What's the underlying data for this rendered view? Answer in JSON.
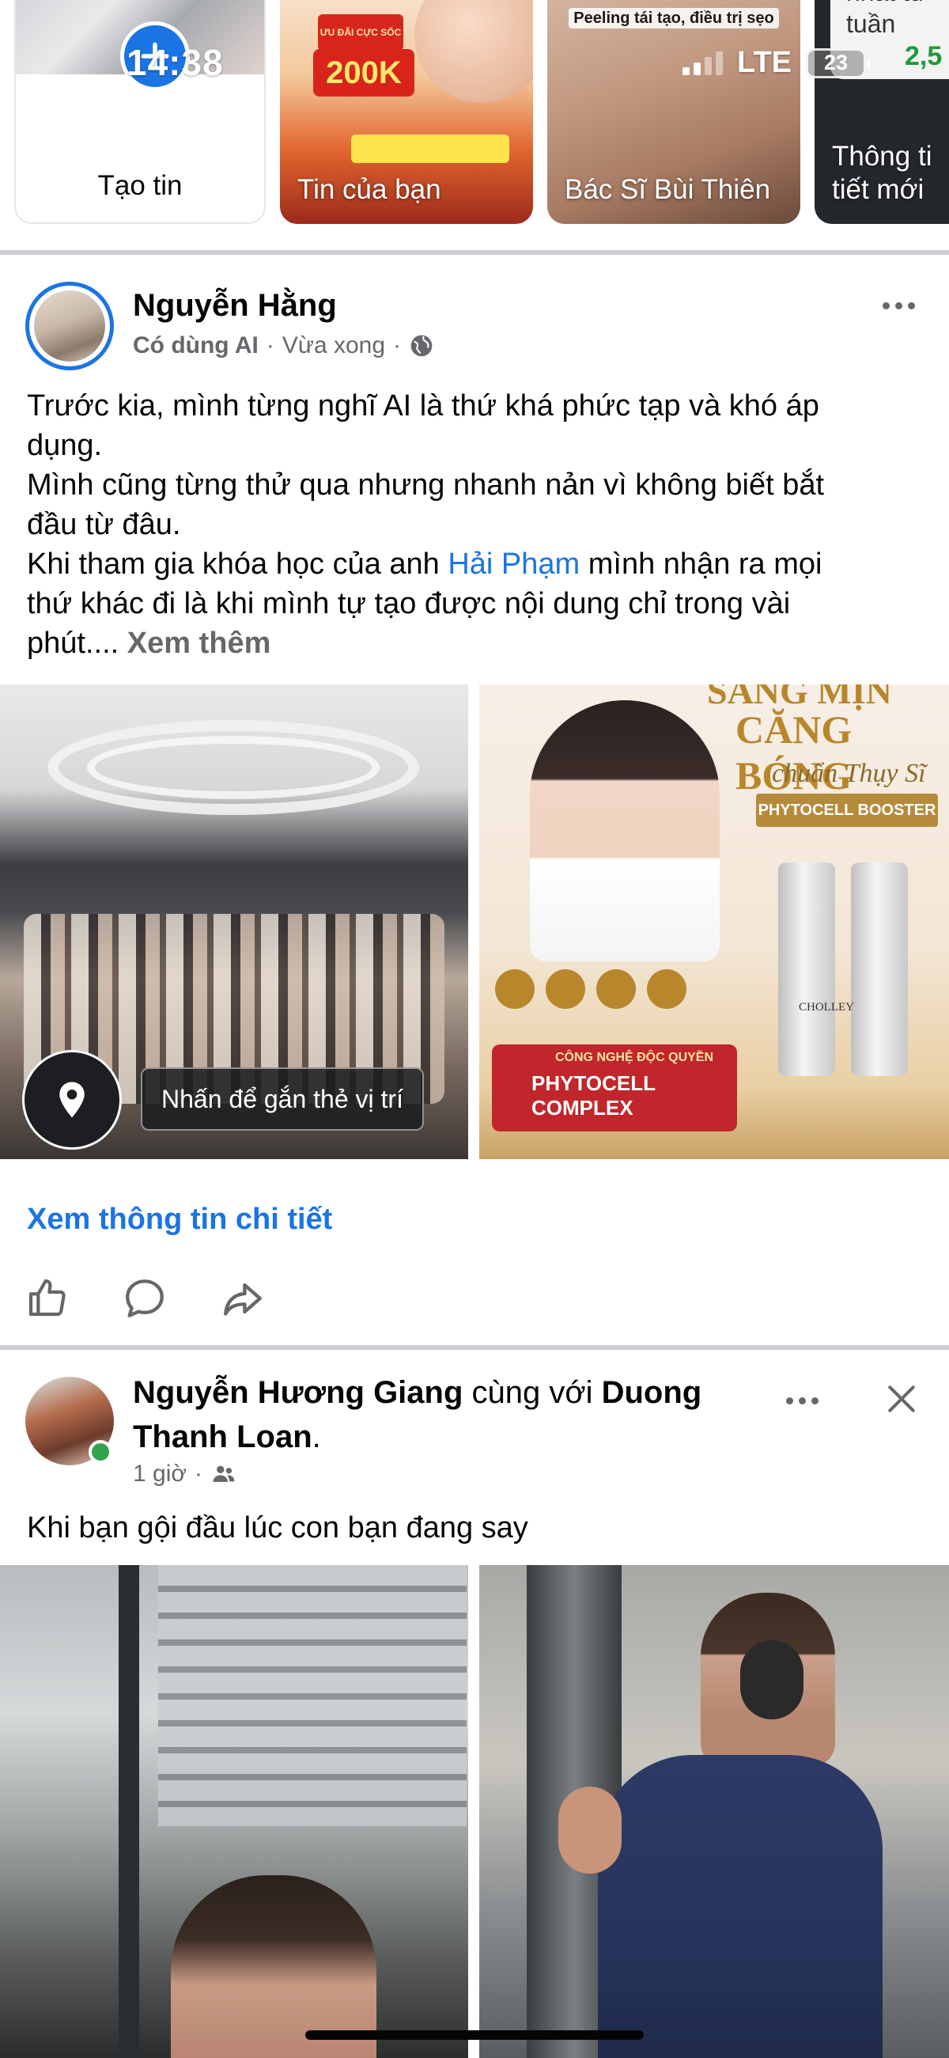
{
  "status_bar": {
    "time": "14:38",
    "network": "LTE",
    "battery": "23"
  },
  "stories": [
    {
      "label": "Tạo tin"
    },
    {
      "label": "Tin của bạn",
      "badge": "200K",
      "promo_text": "ƯU ĐÃI CỰC SỐC"
    },
    {
      "label": "Bác Sĩ Bùi Thiên",
      "caption": "Peeling tái tạo, điều trị sẹo"
    },
    {
      "label_line1": "Thông ti",
      "label_line2": "tiết mới",
      "card_line1": "nhất tu",
      "card_line2": "tuần",
      "card_value": "2,5"
    }
  ],
  "post1": {
    "author": "Nguyễn Hằng",
    "meta_tag": "Có dùng AI",
    "time": "Vừa xong",
    "text_line1": "Trước kia, mình từng nghĩ AI là thứ khá phức tạp và khó áp",
    "text_line2": "dụng.",
    "text_line3": "Mình cũng từng thử qua nhưng nhanh nản vì không biết bắt",
    "text_line4": "đầu từ đâu.",
    "text_line5_a": "Khi tham gia khóa học của anh ",
    "text_line5_link": "Hải Phạm",
    "text_line5_b": " mình nhận ra mọi",
    "text_line6": "thứ khác đi là khi mình tự tạo được nội dung chỉ trong vài",
    "text_line7": "phút.... ",
    "see_more": "Xem thêm",
    "location_tag": "Nhấn để gắn thẻ vị trí",
    "ad_title_line1": "SĂNG MỊN",
    "ad_title_line2": "CĂNG BÓNG",
    "ad_subtitle": "chuẩn Thụy Sĩ",
    "ad_product": "PHYTOCELL BOOSTER",
    "ad_brand": "CHOLLEY",
    "ad_bottom_title": "PHYTOCELL COMPLEX",
    "ad_bottom_sub": "CÔNG NGHỆ ĐỘC QUYỀN",
    "details_link": "Xem thông tin chi tiết"
  },
  "post2": {
    "author": "Nguyễn Hương Giang",
    "with_word": " cùng với ",
    "with_name_line1": "Duong",
    "with_name_line2": "Thanh Loan",
    "period": ".",
    "time": "1 giờ",
    "text": "Khi bạn gội đầu lúc con bạn đang say"
  },
  "colors": {
    "accent": "#1b74e4",
    "secondary_text": "#65676b",
    "separator": "#c9ccd1"
  }
}
